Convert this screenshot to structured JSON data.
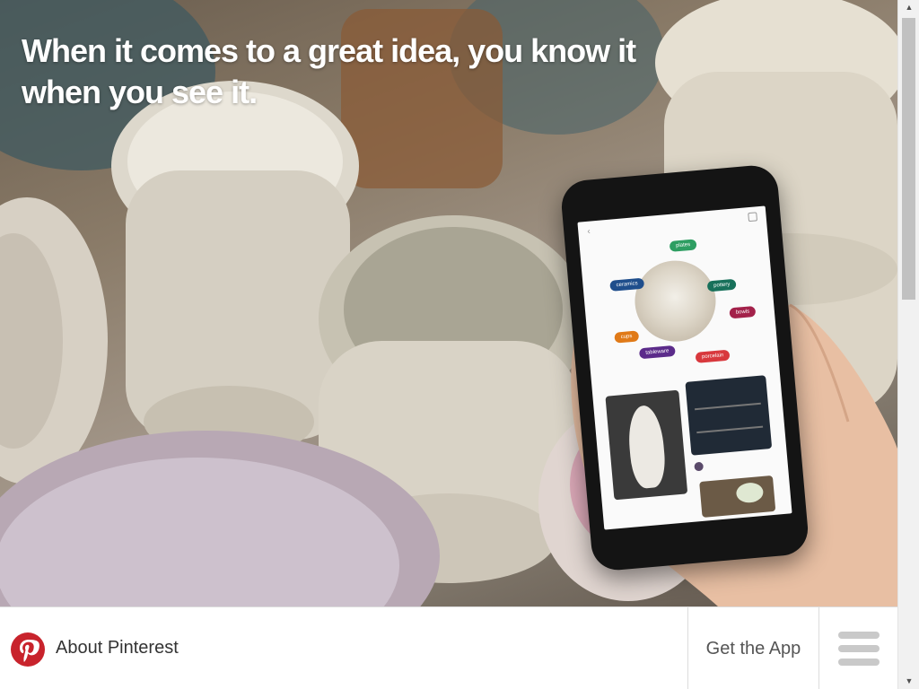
{
  "hero": {
    "headline": "When it comes to a great idea, you know it when you see it."
  },
  "phone_screen": {
    "tags": [
      {
        "label": "plates",
        "color": "#2e9e62"
      },
      {
        "label": "ceramics",
        "color": "#1f4e8c"
      },
      {
        "label": "pottery",
        "color": "#17705a"
      },
      {
        "label": "bowls",
        "color": "#a3214a"
      },
      {
        "label": "cups",
        "color": "#e07a18"
      },
      {
        "label": "tableware",
        "color": "#5b2b8a"
      },
      {
        "label": "porcelain",
        "color": "#d8383d"
      }
    ]
  },
  "footer": {
    "about_label": "About Pinterest",
    "get_app_label": "Get the App"
  },
  "colors": {
    "brand_red": "#e60023",
    "footer_border": "#dcdcdc",
    "menu_bars": "#c9c9c9"
  },
  "icons": {
    "logo": "pinterest-logo",
    "menu": "hamburger-menu-icon",
    "scroll_up": "scroll-up-arrow-icon",
    "scroll_down": "scroll-down-arrow-icon"
  }
}
